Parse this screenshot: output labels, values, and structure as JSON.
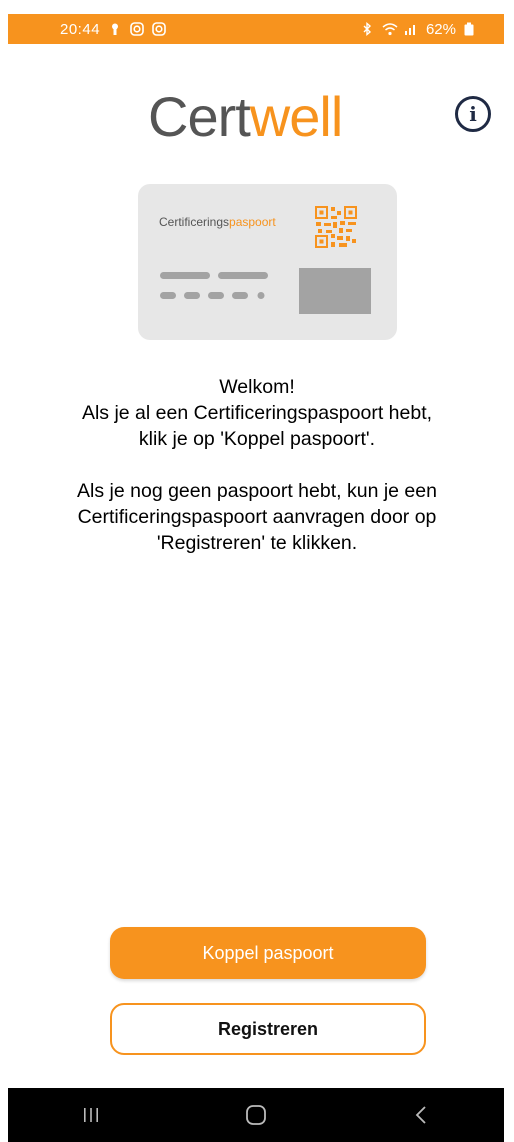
{
  "status_bar": {
    "time": "20:44",
    "battery": "62%",
    "color": "#f7931e",
    "icons_left": [
      "keyhole-icon",
      "instagram-icon",
      "instagram-icon"
    ],
    "icons_right": [
      "bluetooth-icon",
      "wifi-icon",
      "signal-icon",
      "battery-icon"
    ]
  },
  "header": {
    "logo_part1": "Cert",
    "logo_part2": "well",
    "info_glyph": "i"
  },
  "card": {
    "title_part1": "Certificerings",
    "title_part2": "paspoort"
  },
  "welcome": {
    "line1": "Welkom!",
    "line2": "Als je al een Certificeringspaspoort hebt,",
    "line3": "klik je op 'Koppel paspoort'.",
    "line4": "Als je nog geen paspoort hebt, kun je een",
    "line5": "Certificeringspaspoort aanvragen door op",
    "line6": "'Registreren' te klikken."
  },
  "actions": {
    "primary_label": "Koppel paspoort",
    "secondary_label": "Registreren"
  },
  "nav": {
    "icons": [
      "recent-apps-icon",
      "home-icon",
      "back-icon"
    ]
  },
  "colors": {
    "accent": "#f7931e",
    "logo_gray": "#555555",
    "card_bg": "#e7e7e7",
    "info_icon": "#1f2a44"
  }
}
